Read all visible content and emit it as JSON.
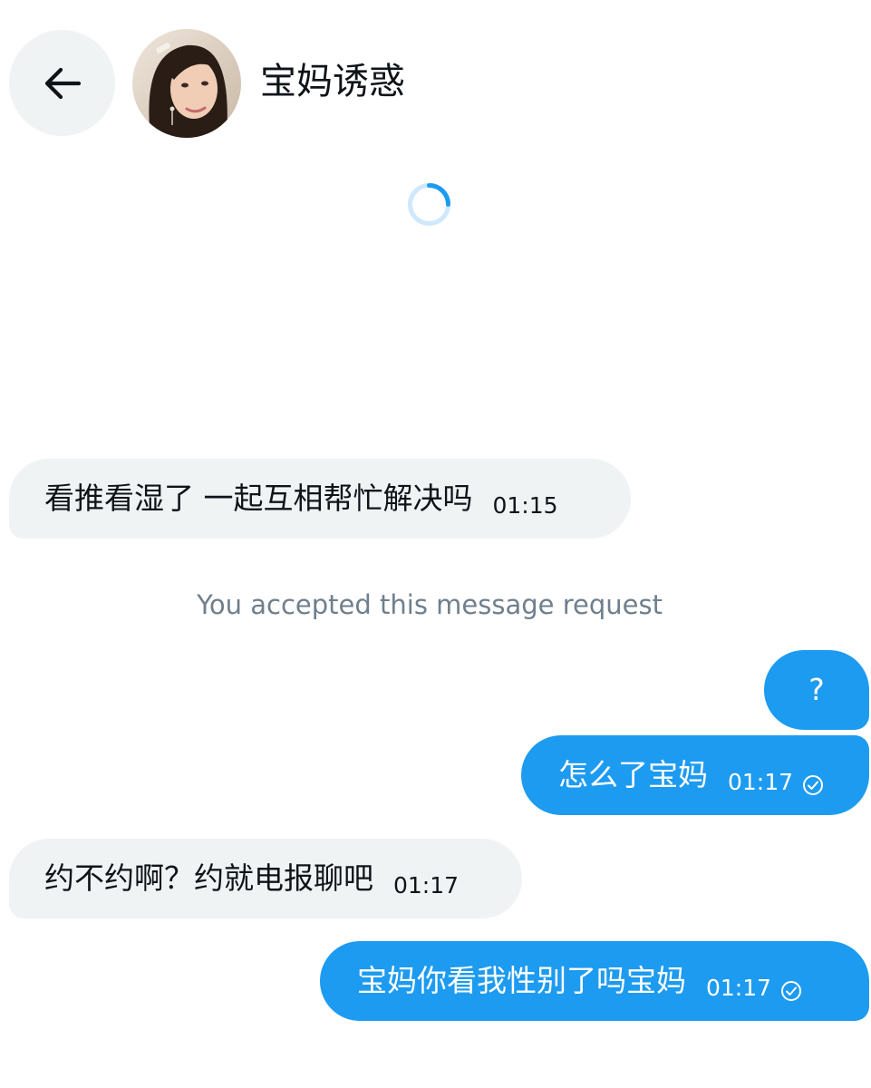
{
  "header": {
    "back_icon": "arrow-left-icon",
    "contact_name": "宝妈诱惑",
    "avatar_icon": "profile-photo"
  },
  "loading_indicator": "spinner",
  "colors": {
    "incoming_bubble": "#eff3f4",
    "outgoing_bubble": "#1d9bf0",
    "system_text": "#6f7f8c",
    "spinner": "#1d9bf0"
  },
  "messages": [
    {
      "direction": "in",
      "text": "看推看湿了 一起互相帮忙解决吗",
      "time": "01:15"
    },
    {
      "direction": "system",
      "text": "You accepted this message request"
    },
    {
      "direction": "out",
      "text": "?",
      "time": ""
    },
    {
      "direction": "out",
      "text": "怎么了宝妈",
      "time": "01:17",
      "status_icon": "check-circle-icon"
    },
    {
      "direction": "in",
      "text": "约不约啊？约就电报聊吧",
      "time": "01:17"
    },
    {
      "direction": "out",
      "text": "宝妈你看我性别了吗宝妈",
      "time": "01:17",
      "status_icon": "check-circle-icon"
    }
  ]
}
